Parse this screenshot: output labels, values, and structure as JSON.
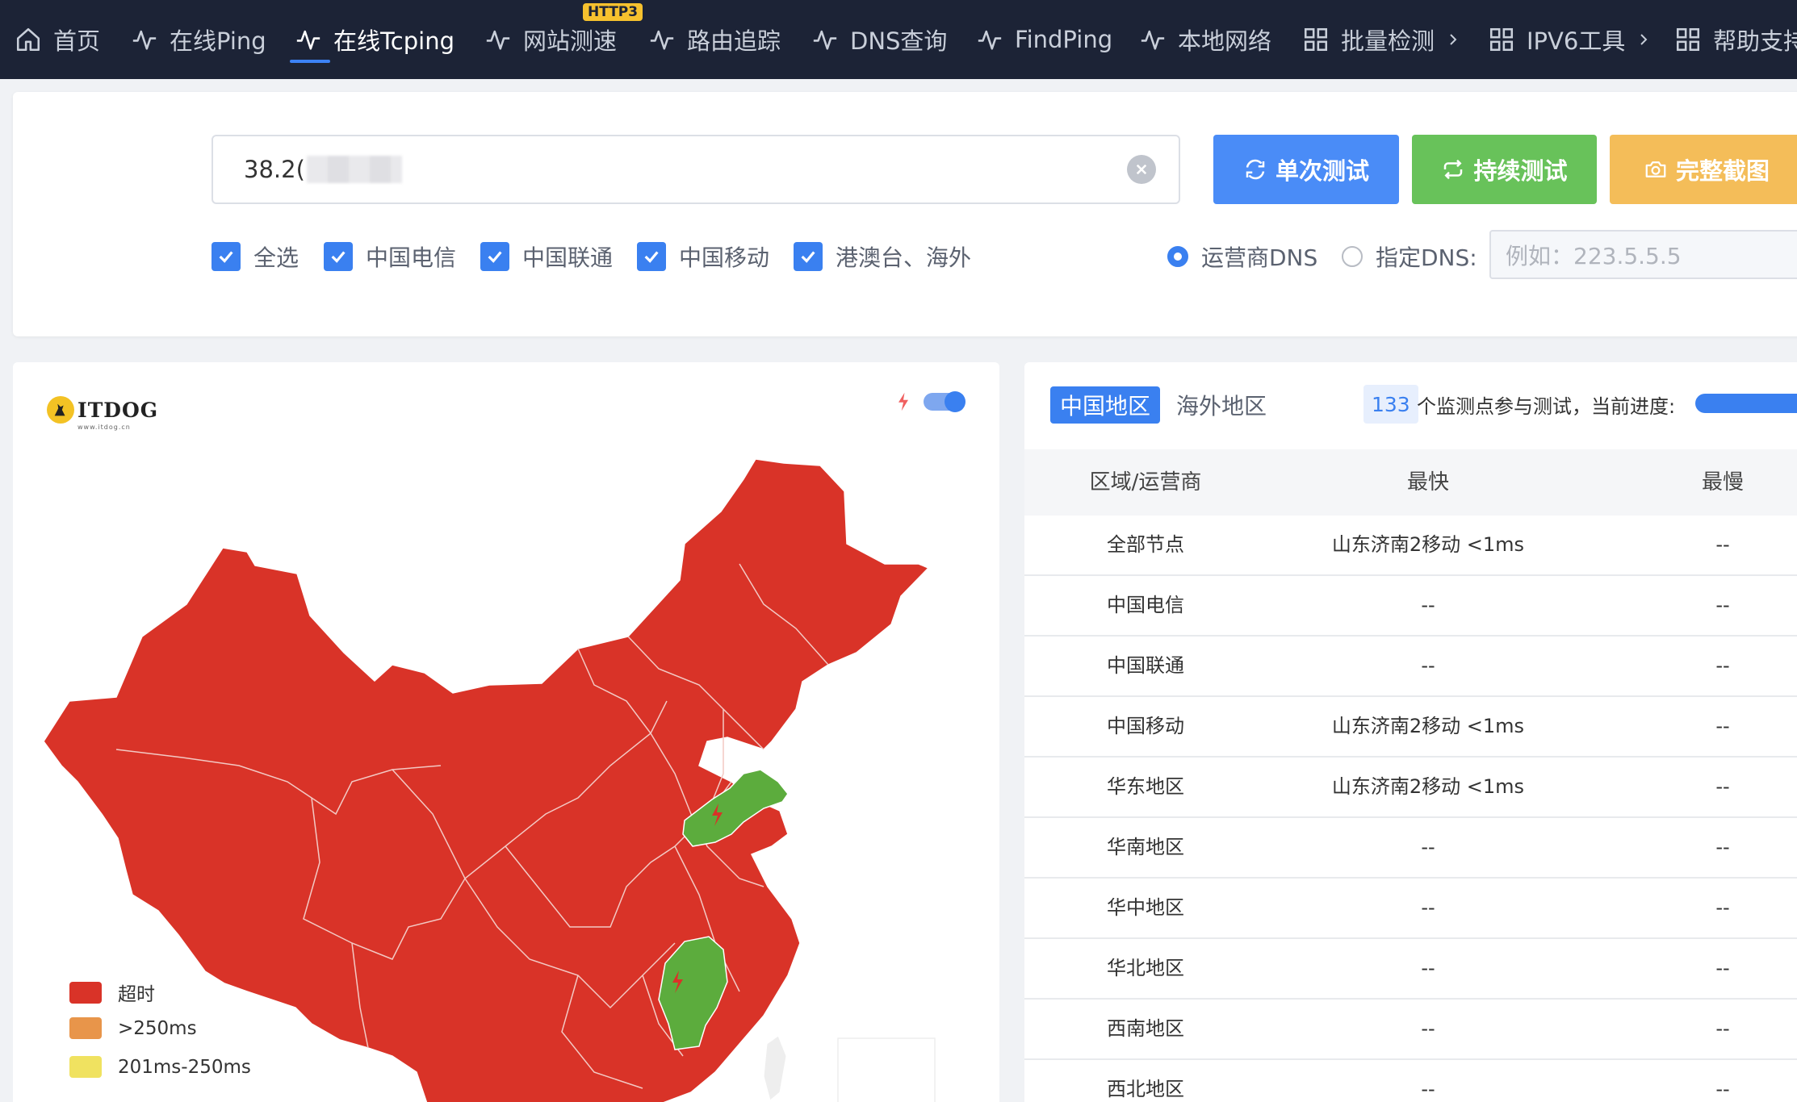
{
  "nav": {
    "items": [
      {
        "label": "首页",
        "icon": "home-icon"
      },
      {
        "label": "在线Ping",
        "icon": "pulse-icon"
      },
      {
        "label": "在线Tcping",
        "icon": "pulse-icon"
      },
      {
        "label": "网站测速",
        "icon": "pulse-icon",
        "badge": "HTTP3"
      },
      {
        "label": "路由追踪",
        "icon": "pulse-icon"
      },
      {
        "label": "DNS查询",
        "icon": "pulse-icon"
      },
      {
        "label": "FindPing",
        "icon": "pulse-icon"
      },
      {
        "label": "本地网络",
        "icon": "pulse-icon"
      },
      {
        "label": "批量检测",
        "icon": "grid-icon",
        "has_submenu": true
      },
      {
        "label": "IPV6工具",
        "icon": "grid-icon",
        "has_submenu": true
      },
      {
        "label": "帮助支持",
        "icon": "grid-icon"
      }
    ],
    "active_index": 2
  },
  "search": {
    "value": "38.2("
  },
  "buttons": {
    "single_test": "单次测试",
    "continuous_test": "持续测试",
    "full_screenshot": "完整截图"
  },
  "filters": [
    {
      "label": "全选",
      "checked": true
    },
    {
      "label": "中国电信",
      "checked": true
    },
    {
      "label": "中国联通",
      "checked": true
    },
    {
      "label": "中国移动",
      "checked": true
    },
    {
      "label": "港澳台、海外",
      "checked": true
    }
  ],
  "dns": {
    "options": [
      {
        "label": "运营商DNS",
        "selected": true
      },
      {
        "label": "指定DNS:",
        "selected": false
      }
    ],
    "placeholder": "例如：223.5.5.5"
  },
  "map": {
    "logo_text": "ITDOG",
    "logo_subtext": "www.itdog.cn",
    "realtime_toggle_on": true,
    "colors": {
      "timeout": "#d93328",
      "ok": "#5cac3d",
      "border": "#ffffff"
    },
    "legend": [
      {
        "label": "超时",
        "color": "#d93328"
      },
      {
        "label": ">250ms",
        "color": "#e8954a"
      },
      {
        "label": "201ms-250ms",
        "color": "#f0e260"
      }
    ]
  },
  "results": {
    "tabs": [
      {
        "label": "中国地区",
        "active": true
      },
      {
        "label": "海外地区",
        "active": false
      }
    ],
    "node_count": "133",
    "count_text": "个监测点参与测试，当前进度:",
    "progress_percent": 100,
    "columns": [
      "区域/运营商",
      "最快",
      "最慢"
    ],
    "rows": [
      {
        "region": "全部节点",
        "fastest": "山东济南2移动 <1ms",
        "slowest": "--"
      },
      {
        "region": "中国电信",
        "fastest": "--",
        "slowest": "--"
      },
      {
        "region": "中国联通",
        "fastest": "--",
        "slowest": "--"
      },
      {
        "region": "中国移动",
        "fastest": "山东济南2移动 <1ms",
        "slowest": "--"
      },
      {
        "region": "华东地区",
        "fastest": "山东济南2移动 <1ms",
        "slowest": "--"
      },
      {
        "region": "华南地区",
        "fastest": "--",
        "slowest": "--"
      },
      {
        "region": "华中地区",
        "fastest": "--",
        "slowest": "--"
      },
      {
        "region": "华北地区",
        "fastest": "--",
        "slowest": "--"
      },
      {
        "region": "西南地区",
        "fastest": "--",
        "slowest": "--"
      },
      {
        "region": "西北地区",
        "fastest": "--",
        "slowest": "--"
      }
    ]
  }
}
